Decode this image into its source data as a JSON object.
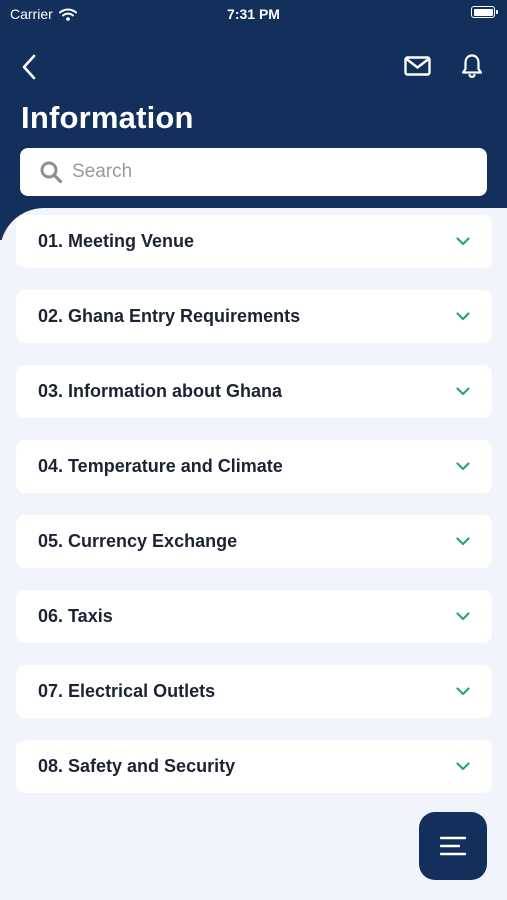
{
  "status_bar": {
    "carrier": "Carrier",
    "time": "7:31 PM"
  },
  "header": {
    "title": "Information"
  },
  "search": {
    "placeholder": "Search",
    "value": ""
  },
  "icons": {
    "back": "chevron-left-icon",
    "mail": "mail-icon",
    "bell": "bell-icon",
    "search": "search-icon",
    "expand": "chevron-down-icon",
    "menu": "menu-icon"
  },
  "items": [
    {
      "label": "01. Meeting Venue"
    },
    {
      "label": "02. Ghana Entry Requirements"
    },
    {
      "label": "03. Information about Ghana"
    },
    {
      "label": "04. Temperature and Climate"
    },
    {
      "label": "05. Currency Exchange"
    },
    {
      "label": "06. Taxis"
    },
    {
      "label": "07. Electrical Outlets"
    },
    {
      "label": "08. Safety and Security"
    }
  ],
  "colors": {
    "primary": "#12305b",
    "accent": "#2f9e8f",
    "background": "#f2f4fb",
    "text": "#1c2333"
  }
}
